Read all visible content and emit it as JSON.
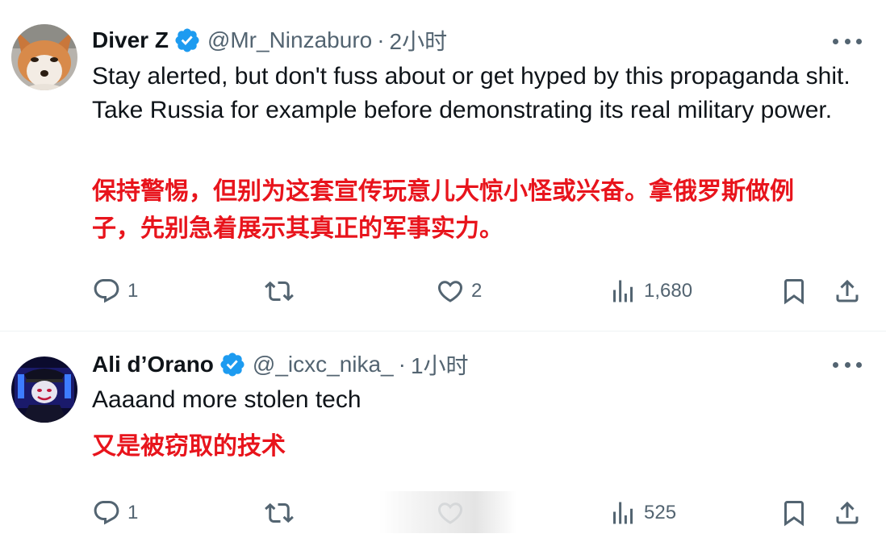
{
  "tweets": [
    {
      "author": {
        "name": "Diver Z",
        "handle": "@Mr_Ninzaburo",
        "verified": true,
        "avatar": "fox-avatar"
      },
      "separator": "·",
      "time": "2小时",
      "text": "Stay alerted, but don't fuss about or get hyped by this propaganda shit. Take Russia for example before demonstrating its real military power.",
      "translation_lines": [
        "保持警惕，但别为这套宣传玩意儿大惊小怪或兴奋。拿俄罗斯做例",
        "子，先别急着展示其真正的军事实力。"
      ],
      "actions": {
        "replies": "1",
        "reposts": "",
        "likes": "2",
        "views": "1,680"
      }
    },
    {
      "author": {
        "name": "Ali d’Orano",
        "handle": "@_icxc_nika_",
        "verified": true,
        "avatar": "clown-officer-avatar"
      },
      "separator": "·",
      "time": "1小时",
      "text": "Aaaand more stolen tech",
      "translation_lines": [
        "又是被窃取的技术"
      ],
      "actions": {
        "replies": "1",
        "reposts": "",
        "likes": "",
        "views": "525"
      }
    }
  ],
  "colors": {
    "text_primary": "#0f1419",
    "text_secondary": "#536471",
    "verified_badge": "#1d9bf0",
    "translation_red": "#e8141c",
    "divider": "#eff3f4"
  },
  "icons": {
    "reply": "reply-icon",
    "repost": "repost-icon",
    "like": "heart-icon",
    "views": "views-icon",
    "bookmark": "bookmark-icon",
    "share": "share-icon",
    "more": "more-icon",
    "verified": "verified-badge-icon"
  }
}
